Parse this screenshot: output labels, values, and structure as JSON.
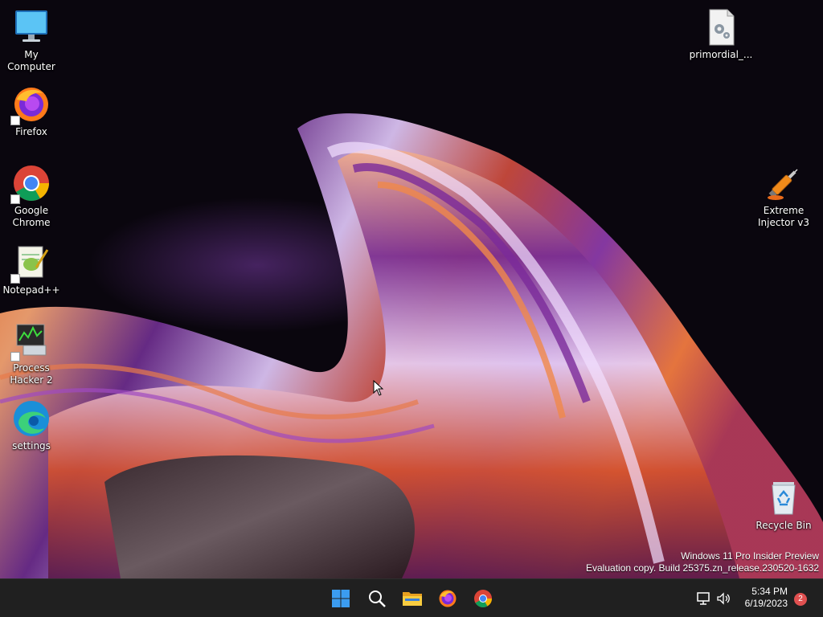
{
  "desktop_icons": {
    "my_computer": "My Computer",
    "firefox": "Firefox",
    "chrome_line1": "Google",
    "chrome_line2": "Chrome",
    "notepadpp": "Notepad++",
    "process_hacker_line1": "Process",
    "process_hacker_line2": "Hacker 2",
    "settings": "settings",
    "primordial": "primordial_...",
    "injector_line1": "Extreme",
    "injector_line2": "Injector v3",
    "recycle_bin": "Recycle Bin"
  },
  "watermark": {
    "line1": "Windows 11 Pro Insider Preview",
    "line2": "Evaluation copy. Build 25375.zn_release.230520-1632"
  },
  "taskbar": {
    "pinned": [
      "start-icon",
      "search-icon",
      "file-explorer-icon",
      "firefox-icon",
      "chrome-icon"
    ],
    "tray": [
      "network-icon",
      "volume-icon"
    ],
    "time": "5:34 PM",
    "date": "6/19/2023",
    "notification_count": "2"
  },
  "colors": {
    "taskbar_bg": "#202020",
    "start_blue": "#3b9cf0",
    "notification_red": "#e05050"
  }
}
